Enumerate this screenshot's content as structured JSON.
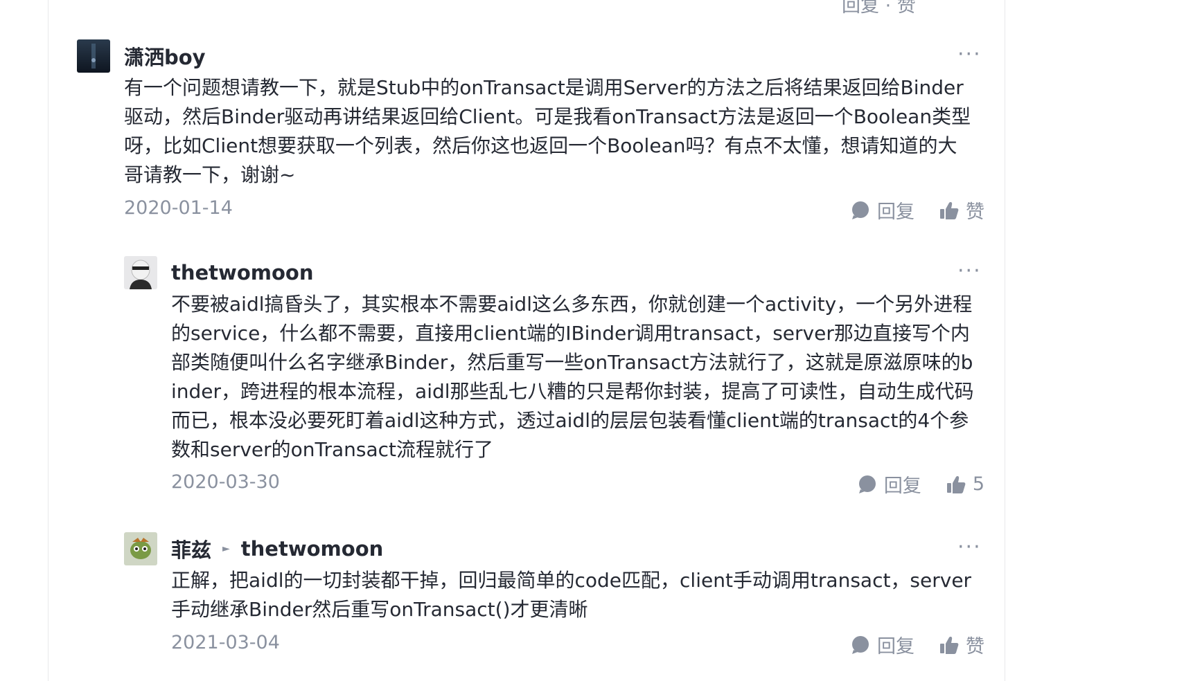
{
  "top_fragment": "回复 · 赞",
  "comments": [
    {
      "author": "潇洒boy",
      "content": "有一个问题想请教一下，就是Stub中的onTransact是调用Server的方法之后将结果返回给Binder驱动，然后Binder驱动再讲结果返回给Client。可是我看onTransact方法是返回一个Boolean类型呀，比如Client想要获取一个列表，然后你这也返回一个Boolean吗？有点不太懂，想请知道的大哥请教一下，谢谢~",
      "date": "2020-01-14",
      "reply_label": "回复",
      "like_label": "赞"
    },
    {
      "author": "thetwomoon",
      "content": "不要被aidl搞昏头了，其实根本不需要aidl这么多东西，你就创建一个activity，一个另外进程的service，什么都不需要，直接用client端的IBinder调用transact，server那边直接写个内部类随便叫什么名字继承Binder，然后重写一些onTransact方法就行了，这就是原滋原味的binder，跨进程的根本流程，aidl那些乱七八糟的只是帮你封装，提高了可读性，自动生成代码而已，根本没必要死盯着aidl这种方式，透过aidl的层层包装看懂client端的transact的4个参数和server的onTransact流程就行了",
      "date": "2020-03-30",
      "reply_label": "回复",
      "like_label": "5"
    },
    {
      "author": "菲兹",
      "reply_to": "thetwomoon",
      "content": "正解，把aidl的一切封装都干掉，回归最简单的code匹配，client手动调用transact，server手动继承Binder然后重写onTransact()才更清晰",
      "date": "2021-03-04",
      "reply_label": "回复",
      "like_label": "赞"
    }
  ],
  "more_icon": "more-horizontal-icon",
  "colors": {
    "text": "#252933",
    "muted": "#8a919f",
    "border": "#e8e9eb"
  }
}
